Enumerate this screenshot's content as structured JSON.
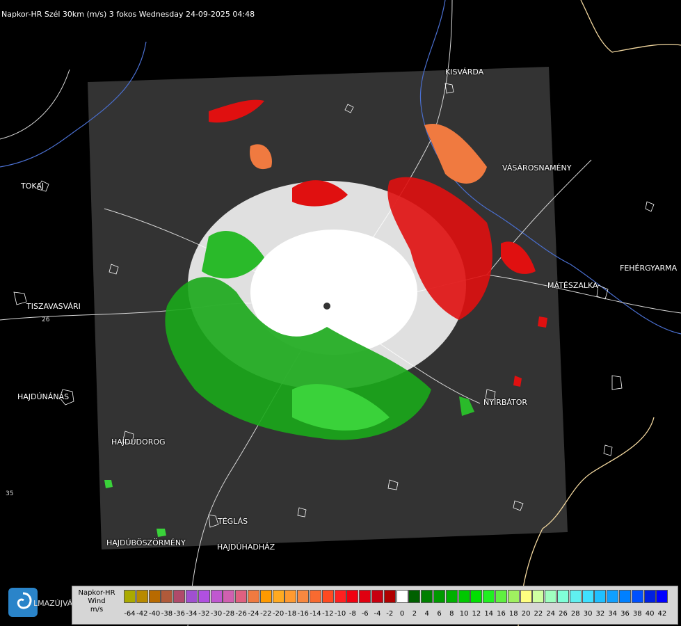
{
  "title": "Napkor-HR Szél 30km (m/s) 3 fokos Wednesday 24-09-2025 04:48",
  "towns": [
    {
      "id": "kisvarda",
      "name": "KISVÁRDA"
    },
    {
      "id": "tokaj",
      "name": "TOKAJ"
    },
    {
      "id": "vasarosnameny",
      "name": "VÁSÁROSNAMÉNY"
    },
    {
      "id": "fehergyarmat",
      "name": "FEHÉRGYARMA"
    },
    {
      "id": "mateszalka",
      "name": "MÁTÉSZALKA"
    },
    {
      "id": "tiszavasvari",
      "name": "TISZAVASVÁRI"
    },
    {
      "id": "hajdunanas",
      "name": "HAJDÚNÁNÁS"
    },
    {
      "id": "nyirbator",
      "name": "NYÍRBÁTOR"
    },
    {
      "id": "hajdudorog",
      "name": "HAJDÚDOROG"
    },
    {
      "id": "teglas",
      "name": "TÉGLÁS"
    },
    {
      "id": "hajduboszormeny",
      "name": "HAJDÚBÖSZÖRMÉNY"
    },
    {
      "id": "hajduhadhaz",
      "name": "HAJDÚHADHÁZ"
    }
  ],
  "road_numbers": [
    "26",
    "35"
  ],
  "legend": {
    "caption": [
      "Napkor-HR",
      "Wind",
      "m/s"
    ],
    "unit": "m/s",
    "classes": [
      {
        "value": -64,
        "color": "#aaaa00"
      },
      {
        "value": -42,
        "color": "#b88a00"
      },
      {
        "value": -40,
        "color": "#b86a00"
      },
      {
        "value": -38,
        "color": "#b05a3a"
      },
      {
        "value": -36,
        "color": "#b04a6a"
      },
      {
        "value": -34,
        "color": "#a050d0"
      },
      {
        "value": -32,
        "color": "#b050e0"
      },
      {
        "value": -30,
        "color": "#c058d0"
      },
      {
        "value": -28,
        "color": "#d060b0"
      },
      {
        "value": -26,
        "color": "#e06080"
      },
      {
        "value": -24,
        "color": "#f07a40"
      },
      {
        "value": -22,
        "color": "#ff9a00"
      },
      {
        "value": -20,
        "color": "#ffaa20"
      },
      {
        "value": -18,
        "color": "#ff9a30"
      },
      {
        "value": -16,
        "color": "#f88840"
      },
      {
        "value": -14,
        "color": "#f86a30"
      },
      {
        "value": -12,
        "color": "#ff4a20"
      },
      {
        "value": -10,
        "color": "#ff2020"
      },
      {
        "value": -8,
        "color": "#f00010"
      },
      {
        "value": -6,
        "color": "#e00010"
      },
      {
        "value": -4,
        "color": "#c80010"
      },
      {
        "value": -2,
        "color": "#b00000"
      },
      {
        "value": 0,
        "color": "#ffffff"
      },
      {
        "value": 2,
        "color": "#006000"
      },
      {
        "value": 4,
        "color": "#008000"
      },
      {
        "value": 6,
        "color": "#009a00"
      },
      {
        "value": 8,
        "color": "#00b000"
      },
      {
        "value": 10,
        "color": "#00c800"
      },
      {
        "value": 12,
        "color": "#00e000"
      },
      {
        "value": 14,
        "color": "#20f020"
      },
      {
        "value": 16,
        "color": "#60f040"
      },
      {
        "value": 18,
        "color": "#a0f060"
      },
      {
        "value": 20,
        "color": "#ffff80"
      },
      {
        "value": 22,
        "color": "#d0ffa0"
      },
      {
        "value": 24,
        "color": "#a0ffc0"
      },
      {
        "value": 26,
        "color": "#80ffd8"
      },
      {
        "value": 28,
        "color": "#60f0f0"
      },
      {
        "value": 30,
        "color": "#40e0ff"
      },
      {
        "value": 32,
        "color": "#20c0ff"
      },
      {
        "value": 34,
        "color": "#10a0ff"
      },
      {
        "value": 36,
        "color": "#0080ff"
      },
      {
        "value": 38,
        "color": "#0050ff"
      },
      {
        "value": 40,
        "color": "#0020e0"
      },
      {
        "value": 42,
        "color": "#0000ff"
      }
    ],
    "tick_labels": [
      "-64",
      "-42",
      "-40",
      "-38",
      "-36",
      "-34",
      "-32",
      "-30",
      "-28",
      "-26",
      "-24",
      "-22",
      "-20",
      "-18",
      "-16",
      "-14",
      "-12",
      "-10",
      "-8",
      "-6",
      "-4",
      "-2",
      "0",
      "2",
      "4",
      "6",
      "8",
      "10",
      "12",
      "14",
      "16",
      "18",
      "20",
      "22",
      "24",
      "26",
      "28",
      "30",
      "32",
      "34",
      "36",
      "38",
      "40",
      "42"
    ]
  },
  "logo": {
    "text": "LMAZÚJVÁR",
    "icon": "swirl-logo-icon"
  },
  "colors": {
    "background": "#000000",
    "radar_area": "#333333",
    "boundaries": "#ffffff",
    "rivers": "#4a6fd0",
    "border": "#f4d9a0",
    "roads": "#d8d8d8"
  }
}
